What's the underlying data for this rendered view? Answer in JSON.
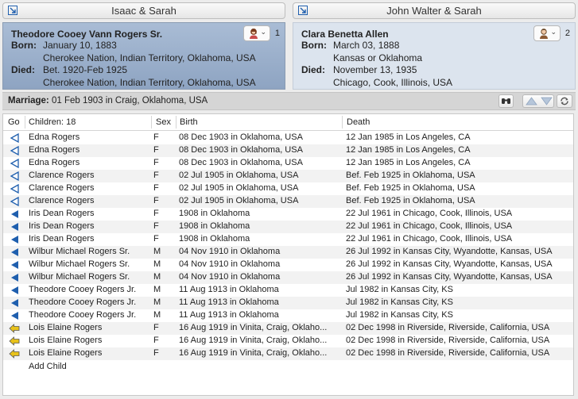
{
  "nav": {
    "left_parents": "Isaac & Sarah",
    "right_parents": "John Walter & Sarah"
  },
  "husband": {
    "name": "Theodore Cooey Vann Rogers Sr.",
    "born_label": "Born:",
    "born_date": "January 10, 1883",
    "born_place": "Cherokee Nation, Indian Territory, Oklahoma, USA",
    "died_label": "Died:",
    "died_date": "Bet. 1920-Feb 1925",
    "died_place": "Cherokee Nation, Indian Territory, Oklahoma, USA",
    "spouse_count": "1"
  },
  "wife": {
    "name": "Clara Benetta Allen",
    "born_label": "Born:",
    "born_date": "March 03, 1888",
    "born_place": "Kansas or Oklahoma",
    "died_label": "Died:",
    "died_date": "November 13, 1935",
    "died_place": "Chicago, Cook, Illinois, USA",
    "spouse_count": "2"
  },
  "marriage": {
    "label": "Marriage:",
    "value": "01 Feb 1903 in Craig, Oklahoma, USA"
  },
  "table": {
    "headers": {
      "go": "Go",
      "children": "Children: 18",
      "sex": "Sex",
      "birth": "Birth",
      "death": "Death"
    },
    "rows": [
      {
        "arrow": "outline",
        "name": "Edna Rogers",
        "sex": "F",
        "birth": "08 Dec 1903 in Oklahoma, USA",
        "death": "12 Jan 1985 in Los Angeles, CA"
      },
      {
        "arrow": "outline",
        "name": "Edna Rogers",
        "sex": "F",
        "birth": "08 Dec 1903 in Oklahoma, USA",
        "death": "12 Jan 1985 in Los Angeles, CA"
      },
      {
        "arrow": "outline",
        "name": "Edna Rogers",
        "sex": "F",
        "birth": "08 Dec 1903 in Oklahoma, USA",
        "death": "12 Jan 1985 in Los Angeles, CA"
      },
      {
        "arrow": "outline",
        "name": "Clarence Rogers",
        "sex": "F",
        "birth": "02 Jul 1905 in Oklahoma, USA",
        "death": "Bef. Feb 1925 in Oklahoma, USA"
      },
      {
        "arrow": "outline",
        "name": "Clarence Rogers",
        "sex": "F",
        "birth": "02 Jul 1905 in Oklahoma, USA",
        "death": "Bef. Feb 1925 in Oklahoma, USA"
      },
      {
        "arrow": "outline",
        "name": "Clarence Rogers",
        "sex": "F",
        "birth": "02 Jul 1905 in Oklahoma, USA",
        "death": "Bef. Feb 1925 in Oklahoma, USA"
      },
      {
        "arrow": "solid",
        "name": "Iris Dean Rogers",
        "sex": "F",
        "birth": "1908 in Oklahoma",
        "death": "22 Jul 1961 in Chicago, Cook, Illinois, USA"
      },
      {
        "arrow": "solid",
        "name": "Iris Dean Rogers",
        "sex": "F",
        "birth": "1908 in Oklahoma",
        "death": "22 Jul 1961 in Chicago, Cook, Illinois, USA"
      },
      {
        "arrow": "solid",
        "name": "Iris Dean Rogers",
        "sex": "F",
        "birth": "1908 in Oklahoma",
        "death": "22 Jul 1961 in Chicago, Cook, Illinois, USA"
      },
      {
        "arrow": "solid",
        "name": "Wilbur Michael Rogers Sr.",
        "sex": "M",
        "birth": "04 Nov 1910 in Oklahoma",
        "death": "26 Jul 1992 in Kansas City, Wyandotte, Kansas, USA"
      },
      {
        "arrow": "solid",
        "name": "Wilbur Michael Rogers Sr.",
        "sex": "M",
        "birth": "04 Nov 1910 in Oklahoma",
        "death": "26 Jul 1992 in Kansas City, Wyandotte, Kansas, USA"
      },
      {
        "arrow": "solid",
        "name": "Wilbur Michael Rogers Sr.",
        "sex": "M",
        "birth": "04 Nov 1910 in Oklahoma",
        "death": "26 Jul 1992 in Kansas City, Wyandotte, Kansas, USA"
      },
      {
        "arrow": "solid",
        "name": "Theodore Cooey Rogers Jr.",
        "sex": "M",
        "birth": "11 Aug 1913 in Oklahoma",
        "death": "Jul 1982 in Kansas City, KS"
      },
      {
        "arrow": "solid",
        "name": "Theodore Cooey Rogers Jr.",
        "sex": "M",
        "birth": "11 Aug 1913 in Oklahoma",
        "death": "Jul 1982 in Kansas City, KS"
      },
      {
        "arrow": "solid",
        "name": "Theodore Cooey Rogers Jr.",
        "sex": "M",
        "birth": "11 Aug 1913 in Oklahoma",
        "death": "Jul 1982 in Kansas City, KS"
      },
      {
        "arrow": "yellow",
        "name": "Lois Elaine Rogers",
        "sex": "F",
        "birth": "16 Aug 1919 in Vinita, Craig, Oklaho...",
        "death": "02 Dec 1998 in Riverside, Riverside, California, USA"
      },
      {
        "arrow": "yellow",
        "name": "Lois Elaine Rogers",
        "sex": "F",
        "birth": "16 Aug 1919 in Vinita, Craig, Oklaho...",
        "death": "02 Dec 1998 in Riverside, Riverside, California, USA"
      },
      {
        "arrow": "yellow",
        "name": "Lois Elaine Rogers",
        "sex": "F",
        "birth": "16 Aug 1919 in Vinita, Craig, Oklaho...",
        "death": "02 Dec 1998 in Riverside, Riverside, California, USA"
      }
    ],
    "add_child": "Add Child"
  },
  "colors": {
    "husband_card": "#9fb3cf",
    "wife_card": "#dce4ee",
    "arrow_blue": "#1f5fae",
    "arrow_yellow": "#e8c21a"
  },
  "icons": {
    "nav": "jump-arrow-icon",
    "wife_portrait": "female-portrait-icon",
    "husband_portrait": "male-portrait-icon",
    "binoculars": "binoculars-icon",
    "refresh": "refresh-icon"
  }
}
